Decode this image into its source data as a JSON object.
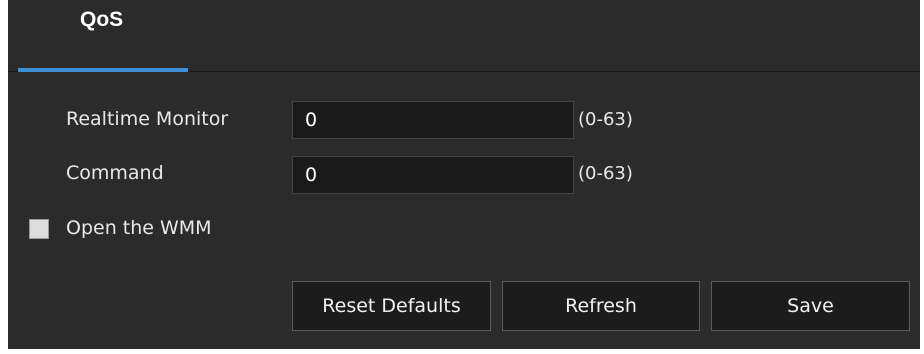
{
  "tabs": [
    {
      "label": "QoS",
      "active": true
    }
  ],
  "form": {
    "realtime_monitor": {
      "label": "Realtime Monitor",
      "value": "0",
      "range": "(0-63)"
    },
    "command": {
      "label": "Command",
      "value": "0",
      "range": "(0-63)"
    },
    "wmm": {
      "label": "Open the WMM",
      "checked": false
    }
  },
  "buttons": {
    "reset": "Reset Defaults",
    "refresh": "Refresh",
    "save": "Save"
  },
  "colors": {
    "background": "#2b2b2b",
    "tab_accent": "#3d8fd6",
    "field_bg": "#1a1a1a",
    "button_bg": "#1c1c1c"
  }
}
